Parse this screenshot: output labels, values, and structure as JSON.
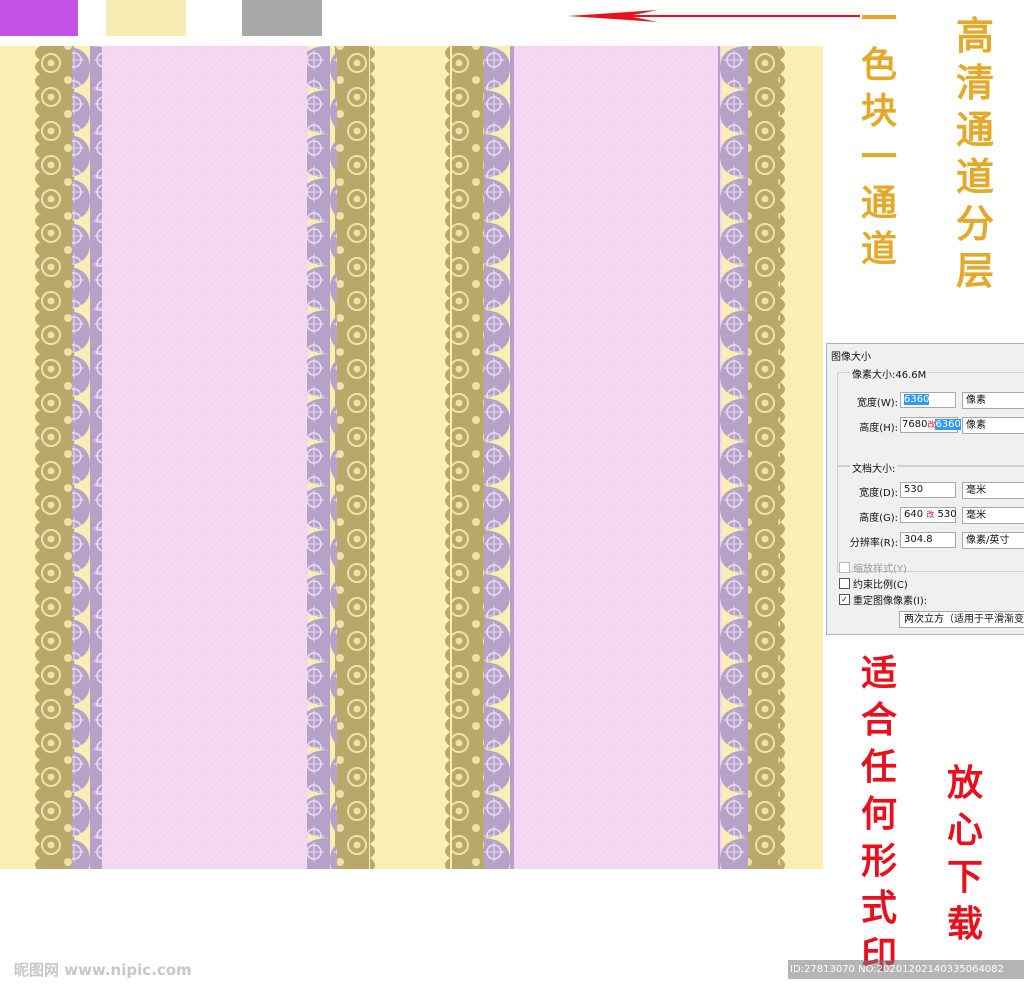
{
  "palette": {
    "swatches": [
      {
        "name": "purple",
        "color": "#c451e8"
      },
      {
        "name": "yellow",
        "color": "#f8edb2"
      },
      {
        "name": "gray",
        "color": "#a8a8a8"
      }
    ],
    "pattern_colors": {
      "background": "#fbeeb3",
      "stripe": "#f5d9f3",
      "lace_gold": "#b8a96a",
      "lace_lilac": "#b6a2c9"
    },
    "arrow_color": "#e8101c"
  },
  "promo": {
    "color_block_text": "一色块一通道",
    "hd_layers_text": "高清通道分层",
    "fit_print_text": "适合任何形式印",
    "download_text": "放心下载"
  },
  "dialog": {
    "title": "图像大小",
    "pixel_size_label": "像素大小:46.6M",
    "width_label": "宽度(W):",
    "width_value": "6360",
    "height_label": "高度(H):",
    "height_original": "7680",
    "height_mark": "改",
    "height_value": "6360",
    "pixel_unit": "像素",
    "doc_size_label": "文档大小:",
    "doc_width_label": "宽度(D):",
    "doc_width_value": "530",
    "doc_height_label": "高度(G):",
    "doc_height_original": "640",
    "doc_height_mark": "改",
    "doc_height_value": "530",
    "mm_unit": "毫米",
    "resolution_label": "分辨率(R):",
    "resolution_value": "304.8",
    "resolution_unit": "像素/英寸",
    "scale_styles_label": "缩放样式(Y)",
    "constrain_label": "约束比例(C)",
    "resample_label": "重定图像像素(I):",
    "resample_method": "两次立方（适用于平滑渐变",
    "resample_checked": "✓"
  },
  "watermark": {
    "logo": "昵图网 www.nipic.com",
    "id_text": "ID:27813070 NO:20201202140335064082"
  }
}
